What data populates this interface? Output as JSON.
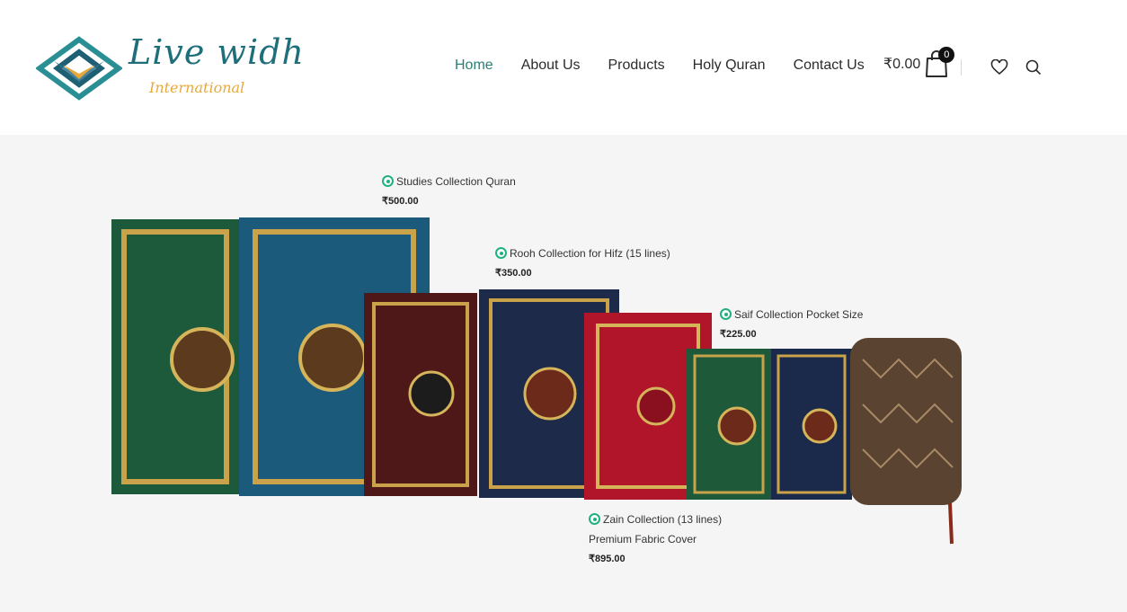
{
  "brand": {
    "line1": "Live widh",
    "line2": "International"
  },
  "nav": {
    "items": [
      {
        "label": "Home"
      },
      {
        "label": "About Us"
      },
      {
        "label": "Products"
      },
      {
        "label": "Holy Quran"
      },
      {
        "label": "Contact Us"
      }
    ]
  },
  "cart": {
    "price": "₹0.00",
    "count": "0"
  },
  "icons": {
    "cart": "shopping-bag-icon",
    "wishlist": "heart-icon",
    "search": "search-icon"
  },
  "colors": {
    "accent": "#2a7f74",
    "hotspot": "#21b07f",
    "hero_bg": "#f5f5f5",
    "logo_teal": "#1e6f7a",
    "logo_gold": "#e7a93a"
  },
  "hotspots": [
    {
      "title": "Studies Collection Quran",
      "subtitle": "",
      "price": "₹500.00"
    },
    {
      "title": "Rooh Collection for Hifz (15 lines)",
      "subtitle": "",
      "price": "₹350.00"
    },
    {
      "title": "Saif Collection Pocket Size",
      "subtitle": "",
      "price": "₹225.00"
    },
    {
      "title": "Zain Collection (13 lines)",
      "subtitle": "Premium Fabric Cover",
      "price": "₹895.00"
    }
  ]
}
